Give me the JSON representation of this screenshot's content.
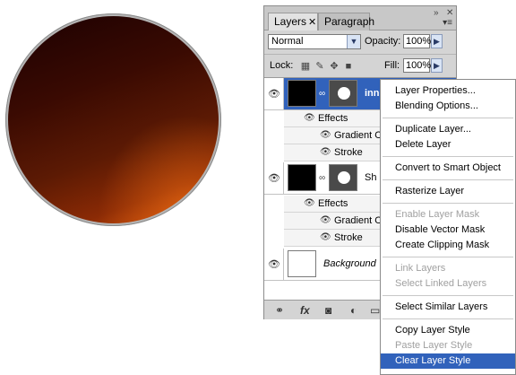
{
  "panel": {
    "tabs": [
      {
        "label": "Layers"
      },
      {
        "label": "Paragraph"
      }
    ],
    "blend_mode": "Normal",
    "opacity_label": "Opacity:",
    "opacity_value": "100%",
    "lock_label": "Lock:",
    "fill_label": "Fill:",
    "fill_value": "100%"
  },
  "layers": [
    {
      "name": "inn",
      "selected": true,
      "effects_label": "Effects",
      "effects": [
        "Gradient O",
        "Stroke"
      ]
    },
    {
      "name": "Sh",
      "selected": false,
      "effects_label": "Effects",
      "effects": [
        "Gradient O",
        "Stroke"
      ]
    },
    {
      "name": "Background",
      "selected": false
    }
  ],
  "context_menu": {
    "items": [
      {
        "label": "Layer Properties...",
        "enabled": true
      },
      {
        "label": "Blending Options...",
        "enabled": true
      },
      {
        "label": "Duplicate Layer...",
        "enabled": true
      },
      {
        "label": "Delete Layer",
        "enabled": true
      },
      {
        "label": "Convert to Smart Object",
        "enabled": true
      },
      {
        "label": "Rasterize Layer",
        "enabled": true
      },
      {
        "label": "Enable Layer Mask",
        "enabled": false
      },
      {
        "label": "Disable Vector Mask",
        "enabled": true
      },
      {
        "label": "Create Clipping Mask",
        "enabled": true
      },
      {
        "label": "Link Layers",
        "enabled": false
      },
      {
        "label": "Select Linked Layers",
        "enabled": false
      },
      {
        "label": "Select Similar Layers",
        "enabled": true
      },
      {
        "label": "Copy Layer Style",
        "enabled": true
      },
      {
        "label": "Paste Layer Style",
        "enabled": false
      },
      {
        "label": "Clear Layer Style",
        "enabled": true,
        "highlighted": true
      }
    ]
  },
  "icons": {
    "eye": "eye-icon",
    "chain": "link-icon",
    "fx": "fx-icon"
  },
  "colors": {
    "selection": "#3162bb",
    "circle_dark": "#1c0101",
    "circle_light": "#d8560e"
  }
}
